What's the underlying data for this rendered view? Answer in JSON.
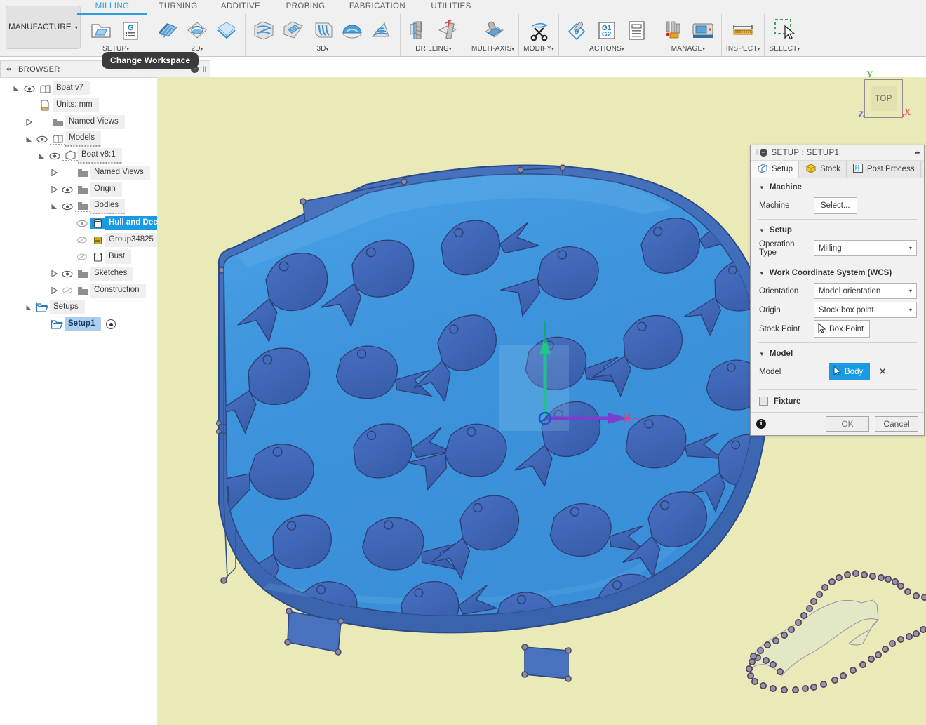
{
  "ribbon": {
    "workspace_button": {
      "label": "MANUFACTURE",
      "caret": "▾"
    },
    "tabs": [
      {
        "label": "MILLING",
        "active": true
      },
      {
        "label": "TURNING",
        "active": false
      },
      {
        "label": "ADDITIVE",
        "active": false
      },
      {
        "label": "PROBING",
        "active": false
      },
      {
        "label": "FABRICATION",
        "active": false
      },
      {
        "label": "UTILITIES",
        "active": false
      }
    ],
    "groups": [
      {
        "label": "SETUP",
        "caret": "▾",
        "icons": [
          "new-setup-icon",
          "new-folder-g-code-icon"
        ]
      },
      {
        "label": "2D",
        "caret": "▾",
        "icons": [
          "face-icon",
          "adaptive2d-icon",
          "contour2d-icon"
        ]
      },
      {
        "label": "3D",
        "caret": "▾",
        "icons": [
          "adaptive3d-icon",
          "pocket3d-icon",
          "parallel3d-icon",
          "scallop3d-icon",
          "spiral3d-icon"
        ]
      },
      {
        "label": "DRILLING",
        "caret": "▾",
        "icons": [
          "drill-icon",
          "thread-mill-icon"
        ]
      },
      {
        "label": "MULTI-AXIS",
        "caret": "▾",
        "icons": [
          "multi-axis-contour-icon"
        ]
      },
      {
        "label": "MODIFY",
        "caret": "▾",
        "icons": [
          "trim-scissors-icon"
        ]
      },
      {
        "label": "ACTIONS",
        "caret": "▾",
        "icons": [
          "simulate-icon",
          "post-process-g1g2-icon",
          "setup-sheet-icon"
        ]
      },
      {
        "label": "MANAGE",
        "caret": "▾",
        "icons": [
          "tool-library-icon",
          "machine-library-icon"
        ]
      },
      {
        "label": "INSPECT",
        "caret": "▾",
        "icons": [
          "measure-ruler-icon"
        ]
      },
      {
        "label": "SELECT",
        "caret": "▾",
        "icons": [
          "select-marquee-icon"
        ]
      }
    ],
    "tooltip": "Change Workspace"
  },
  "browser": {
    "title": "BROWSER",
    "collapse_icon": "◂◂",
    "minimize_icon": "−",
    "grip_icon": "‖",
    "items": [
      {
        "label": "Boat v7",
        "indent": 0,
        "twist": "open",
        "eye": "visible",
        "icon": "component-icon",
        "state": "normal"
      },
      {
        "label": "Units: mm",
        "indent": 1,
        "twist": "none",
        "eye": "none",
        "icon": "units-doc-icon",
        "state": "normal"
      },
      {
        "label": "Named Views",
        "indent": 1,
        "twist": "closed",
        "eye": "none",
        "icon": "folder-icon",
        "state": "normal"
      },
      {
        "label": "Models",
        "indent": 1,
        "twist": "open",
        "eye": "visible",
        "icon": "component-icon",
        "state": "dashed"
      },
      {
        "label": "Boat v8:1",
        "indent": 2,
        "twist": "open",
        "eye": "visible",
        "icon": "body-box-icon",
        "state": "dashed"
      },
      {
        "label": "Named Views",
        "indent": 3,
        "twist": "closed",
        "eye": "none",
        "icon": "folder-icon",
        "state": "normal"
      },
      {
        "label": "Origin",
        "indent": 3,
        "twist": "closed",
        "eye": "visible",
        "icon": "folder-icon",
        "state": "normal"
      },
      {
        "label": "Bodies",
        "indent": 3,
        "twist": "open",
        "eye": "visible",
        "icon": "folder-icon",
        "state": "dashed"
      },
      {
        "label": "Hull and Deck",
        "indent": 4,
        "twist": "none",
        "eye": "dim",
        "icon": "body-cyl-icon",
        "state": "selected"
      },
      {
        "label": "Group34825",
        "indent": 4,
        "twist": "none",
        "eye": "hidden",
        "icon": "group-gold-icon",
        "state": "normal"
      },
      {
        "label": "Bust",
        "indent": 4,
        "twist": "none",
        "eye": "hidden",
        "icon": "body-cyl-icon",
        "state": "normal"
      },
      {
        "label": "Sketches",
        "indent": 3,
        "twist": "closed",
        "eye": "visible",
        "icon": "folder-icon",
        "state": "normal"
      },
      {
        "label": "Construction",
        "indent": 3,
        "twist": "closed",
        "eye": "hidden",
        "icon": "folder-icon",
        "state": "normal"
      },
      {
        "label": "Setups",
        "indent": 1,
        "twist": "open",
        "eye": "none",
        "icon": "setup-folder-icon",
        "state": "normal"
      },
      {
        "label": "Setup1",
        "indent": 2,
        "twist": "none",
        "eye": "none",
        "icon": "setup-folder-icon",
        "state": "active",
        "has_dot": true
      }
    ]
  },
  "viewcube": {
    "face_label": "TOP",
    "axis_y": "Y",
    "axis_z": "Z",
    "axis_x": "X"
  },
  "dialog": {
    "title": "SETUP : SETUP1",
    "collapse_icon": "−",
    "grip_icon": "‖",
    "forward_icon": "▸▸",
    "tabs": [
      {
        "label": "Setup",
        "icon": "setup-cube-icon",
        "active": true
      },
      {
        "label": "Stock",
        "icon": "stock-cube-icon",
        "active": false
      },
      {
        "label": "Post Process",
        "icon": "g1g2-icon",
        "active": false
      }
    ],
    "sections": {
      "machine": {
        "title": "Machine",
        "triangle": "▼",
        "field_label": "Machine",
        "button_label": "Select..."
      },
      "setup": {
        "title": "Setup",
        "triangle": "▼",
        "field_label": "Operation Type",
        "value": "Milling",
        "arrow": "▾"
      },
      "wcs": {
        "title": "Work Coordinate System (WCS)",
        "triangle": "▼",
        "orientation_label": "Orientation",
        "orientation_value": "Model orientation",
        "origin_label": "Origin",
        "origin_value": "Stock box point",
        "stock_point_label": "Stock Point",
        "stock_point_button": "Box Point",
        "arrow": "▾"
      },
      "model": {
        "title": "Model",
        "triangle": "▼",
        "field_label": "Model",
        "chip_label": "Body",
        "clear_icon": "✕"
      },
      "fixture": {
        "title": "Fixture",
        "checked": false
      }
    },
    "footer": {
      "info_icon": "i",
      "ok_label": "OK",
      "cancel_label": "Cancel"
    }
  },
  "colors": {
    "canvas_background": "#eae9b8",
    "deck_blue": "#3d94dc",
    "hull_blue": "#3f6cba",
    "fish_blue": "#3e63b8",
    "accent_blue": "#1a9ae2",
    "axis_x": "#8c3fd0",
    "axis_y": "#1ec48a",
    "sketch_fill": "#e3e8c4",
    "sketch_point": "#6b5b78"
  },
  "viewport": {
    "model_name": "boat-hull-and-deck",
    "wcs_gizmo": {
      "x_axis_color": "#8c3fd0",
      "y_axis_color": "#1ec48a",
      "origin_marker": "circle"
    },
    "sketch_profile_name": "bust-sketch-profile"
  }
}
